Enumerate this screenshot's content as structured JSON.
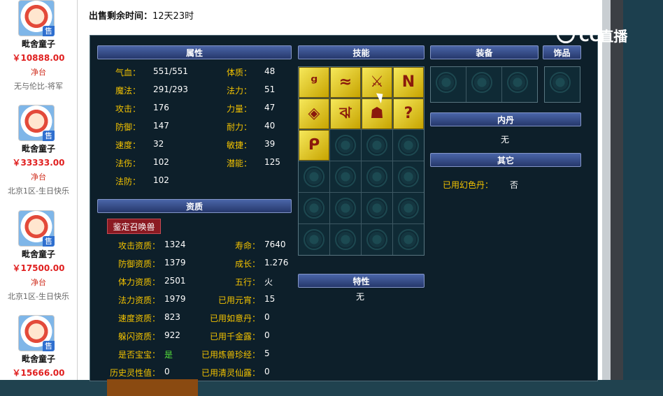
{
  "listing": [
    {
      "name": "毗舍童子",
      "price": "￥10888.00",
      "status": "净台",
      "server": "无与伦比-将军",
      "badge": "售"
    },
    {
      "name": "毗舍童子",
      "price": "￥33333.00",
      "status": "净台",
      "server": "北京1区-生日快乐",
      "badge": "售"
    },
    {
      "name": "毗舍童子",
      "price": "￥17500.00",
      "status": "净台",
      "server": "北京1区-生日快乐",
      "badge": "售"
    },
    {
      "name": "毗舍童子",
      "price": "￥15666.00",
      "status": "",
      "server": "",
      "badge": "售"
    }
  ],
  "timer": {
    "label": "出售剩余时间：",
    "value": "12天23时"
  },
  "logo": {
    "text": "CC直播"
  },
  "headers": {
    "attributes": "属性",
    "skills": "技能",
    "equipment": "装备",
    "accessory": "饰品",
    "neidan": "内丹",
    "other": "其它",
    "aptitude": "资质",
    "traits": "特性"
  },
  "attributes": [
    {
      "label": "气血：",
      "value": "551/551"
    },
    {
      "label": "魔法：",
      "value": "291/293"
    },
    {
      "label": "攻击：",
      "value": "176"
    },
    {
      "label": "防御：",
      "value": "147"
    },
    {
      "label": "速度：",
      "value": "32"
    },
    {
      "label": "法伤：",
      "value": "102"
    },
    {
      "label": "法防：",
      "value": "102"
    }
  ],
  "attributes2": [
    {
      "label": "体质：",
      "value": "48"
    },
    {
      "label": "法力：",
      "value": "51"
    },
    {
      "label": "力量：",
      "value": "47"
    },
    {
      "label": "耐力：",
      "value": "40"
    },
    {
      "label": "敏捷：",
      "value": "39"
    },
    {
      "label": "潜能：",
      "value": "125"
    }
  ],
  "appraise_button": "鉴定召唤兽",
  "aptitude_left": [
    {
      "label": "攻击资质：",
      "value": "1324"
    },
    {
      "label": "防御资质：",
      "value": "1379"
    },
    {
      "label": "体力资质：",
      "value": "2501"
    },
    {
      "label": "法力资质：",
      "value": "1979"
    },
    {
      "label": "速度资质：",
      "value": "823"
    },
    {
      "label": "躲闪资质：",
      "value": "922"
    },
    {
      "label": "是否宝宝：",
      "value": "是"
    },
    {
      "label": "历史灵性值：",
      "value": "0"
    }
  ],
  "aptitude_right": [
    {
      "label": "寿命：",
      "value": "7640"
    },
    {
      "label": "成长：",
      "value": "1.276"
    },
    {
      "label": "五行：",
      "value": "火"
    },
    {
      "label": "已用元宵：",
      "value": "15"
    },
    {
      "label": "已用如意丹：",
      "value": "0"
    },
    {
      "label": "已用千金露：",
      "value": "0"
    },
    {
      "label": "已用炼兽珍经：",
      "value": "5"
    },
    {
      "label": "已用清灵仙露：",
      "value": "0"
    }
  ],
  "skills": [
    {
      "icon": "figure-skill-icon",
      "glyph": "ᵍ"
    },
    {
      "icon": "beast-skill-icon",
      "glyph": "≈"
    },
    {
      "icon": "sword-skill-icon",
      "glyph": "⚔"
    },
    {
      "icon": "banner-skill-icon",
      "glyph": "N"
    },
    {
      "icon": "shield-skill-icon",
      "glyph": "◈"
    },
    {
      "icon": "rune-skill-icon",
      "glyph": "ঝ"
    },
    {
      "icon": "owl-skill-icon",
      "glyph": "☗"
    },
    {
      "icon": "question-skill-icon",
      "glyph": "?"
    },
    {
      "icon": "scroll-skill-icon",
      "glyph": "ᑭ"
    }
  ],
  "skill_slots_total": 24,
  "neidan_value": "无",
  "traits_value": "无",
  "other": {
    "label": "已用幻色丹：",
    "value": "否"
  },
  "colors": {
    "label": "#f2c200",
    "value": "#ffffff",
    "price": "#e02020",
    "panel": "#0d1f2a",
    "header": "#3a5496",
    "baby_value": "#54e03a"
  }
}
